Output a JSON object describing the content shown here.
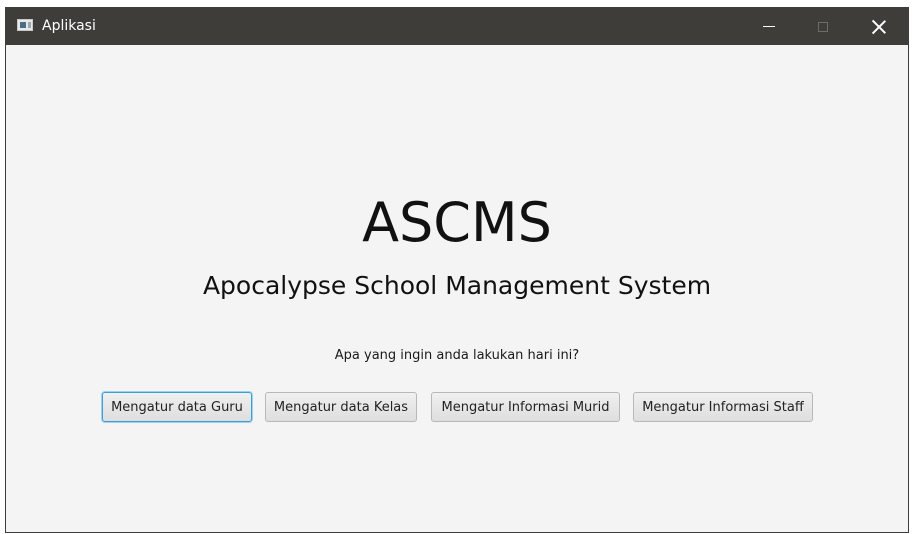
{
  "window": {
    "title": "Aplikasi",
    "controls": {
      "minimize": "minimize-icon",
      "maximize": "maximize-icon",
      "close": "close-icon"
    }
  },
  "main": {
    "app_title": "ASCMS",
    "app_subtitle": "Apocalypse School Management System",
    "prompt": "Apa yang ingin anda lakukan hari ini?",
    "buttons": [
      {
        "label": "Mengatur data Guru",
        "focused": true
      },
      {
        "label": "Mengatur data Kelas",
        "focused": false
      },
      {
        "label": "Mengatur Informasi Murid",
        "focused": false
      },
      {
        "label": "Mengatur Informasi Staff",
        "focused": false
      }
    ]
  },
  "colors": {
    "titlebar": "#3f3d3a",
    "background": "#f4f4f4",
    "focus_ring": "#3b9fd6"
  }
}
